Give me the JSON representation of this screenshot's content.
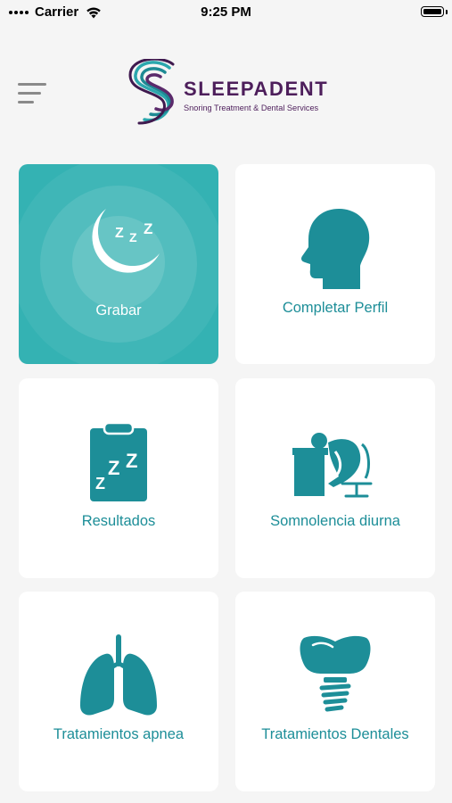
{
  "status_bar": {
    "carrier": "Carrier",
    "time": "9:25 PM"
  },
  "header": {
    "menu_icon": "hamburger-menu-icon",
    "logo": {
      "name": "SLEEPADENT",
      "tagline": "Snoring Treatment & Dental Services"
    }
  },
  "tiles": [
    {
      "label": "Grabar",
      "icon": "moon-sleep-icon",
      "active": true
    },
    {
      "label": "Completar Perfil",
      "icon": "head-profile-icon",
      "active": false
    },
    {
      "label": "Resultados",
      "icon": "clipboard-zzz-icon",
      "active": false
    },
    {
      "label": "Somnolencia diurna",
      "icon": "person-sleeping-desk-icon",
      "active": false
    },
    {
      "label": "Tratamientos apnea",
      "icon": "lungs-icon",
      "active": false
    },
    {
      "label": "Tratamientos Dentales",
      "icon": "dental-implant-icon",
      "active": false
    }
  ],
  "colors": {
    "accent": "#1d8e98",
    "active_tile": "#34b2b3",
    "brand_purple": "#4d1e5b",
    "background": "#f5f5f5"
  }
}
